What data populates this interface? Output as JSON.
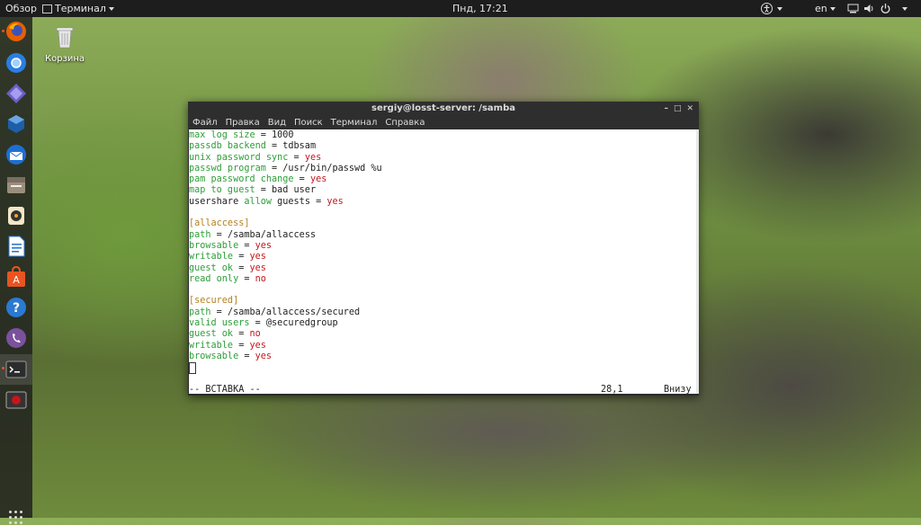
{
  "topbar": {
    "activities": "Обзор",
    "app_menu": "Терминал",
    "clock": "Пнд, 17:21",
    "lang": "en"
  },
  "desktop": {
    "trash_label": "Корзина"
  },
  "terminal": {
    "title": "sergiy@losst-server: /samba",
    "menu": [
      "Файл",
      "Правка",
      "Вид",
      "Поиск",
      "Терминал",
      "Справка"
    ],
    "lines": [
      [
        {
          "t": "max log size",
          "c": "k"
        },
        {
          "t": " = 1000",
          "c": ""
        }
      ],
      [
        {
          "t": "passdb backend",
          "c": "k"
        },
        {
          "t": " = tdbsam",
          "c": ""
        }
      ],
      [
        {
          "t": "unix password sync",
          "c": "k"
        },
        {
          "t": " = ",
          "c": ""
        },
        {
          "t": "yes",
          "c": "v"
        }
      ],
      [
        {
          "t": "passwd program",
          "c": "k"
        },
        {
          "t": " = /usr/bin/passwd %u",
          "c": ""
        }
      ],
      [
        {
          "t": "pam password change",
          "c": "k"
        },
        {
          "t": " = ",
          "c": ""
        },
        {
          "t": "yes",
          "c": "v"
        }
      ],
      [
        {
          "t": "map to guest",
          "c": "k"
        },
        {
          "t": " = bad user",
          "c": ""
        }
      ],
      [
        {
          "t": "usershare ",
          "c": ""
        },
        {
          "t": "allow",
          "c": "k"
        },
        {
          "t": " guests = ",
          "c": ""
        },
        {
          "t": "yes",
          "c": "v"
        }
      ],
      [
        {
          "t": "",
          "c": ""
        }
      ],
      [
        {
          "t": "[allaccess]",
          "c": "s"
        }
      ],
      [
        {
          "t": "path",
          "c": "k"
        },
        {
          "t": " = /samba/allaccess",
          "c": ""
        }
      ],
      [
        {
          "t": "browsable",
          "c": "k"
        },
        {
          "t": " = ",
          "c": ""
        },
        {
          "t": "yes",
          "c": "v"
        }
      ],
      [
        {
          "t": "writable",
          "c": "k"
        },
        {
          "t": " = ",
          "c": ""
        },
        {
          "t": "yes",
          "c": "v"
        }
      ],
      [
        {
          "t": "guest ok",
          "c": "k"
        },
        {
          "t": " = ",
          "c": ""
        },
        {
          "t": "yes",
          "c": "v"
        }
      ],
      [
        {
          "t": "read only",
          "c": "k"
        },
        {
          "t": " = ",
          "c": ""
        },
        {
          "t": "no",
          "c": "v"
        }
      ],
      [
        {
          "t": "",
          "c": ""
        }
      ],
      [
        {
          "t": "[secured]",
          "c": "s"
        }
      ],
      [
        {
          "t": "path",
          "c": "k"
        },
        {
          "t": " = /samba/allaccess/secured",
          "c": ""
        }
      ],
      [
        {
          "t": "valid users",
          "c": "k"
        },
        {
          "t": " = @securedgroup",
          "c": ""
        }
      ],
      [
        {
          "t": "guest ok",
          "c": "k"
        },
        {
          "t": " = ",
          "c": ""
        },
        {
          "t": "no",
          "c": "v"
        }
      ],
      [
        {
          "t": "writable",
          "c": "k"
        },
        {
          "t": " = ",
          "c": ""
        },
        {
          "t": "yes",
          "c": "v"
        }
      ],
      [
        {
          "t": "browsable",
          "c": "k"
        },
        {
          "t": " = ",
          "c": ""
        },
        {
          "t": "yes",
          "c": "v"
        }
      ]
    ],
    "status_mode": "-- ВСТАВКА --",
    "status_pos": "28,1",
    "status_where": "Внизу"
  },
  "colors": {
    "key": "#2e9e38",
    "value": "#c4161c",
    "section": "#b5801e",
    "accent": "#e95420"
  }
}
